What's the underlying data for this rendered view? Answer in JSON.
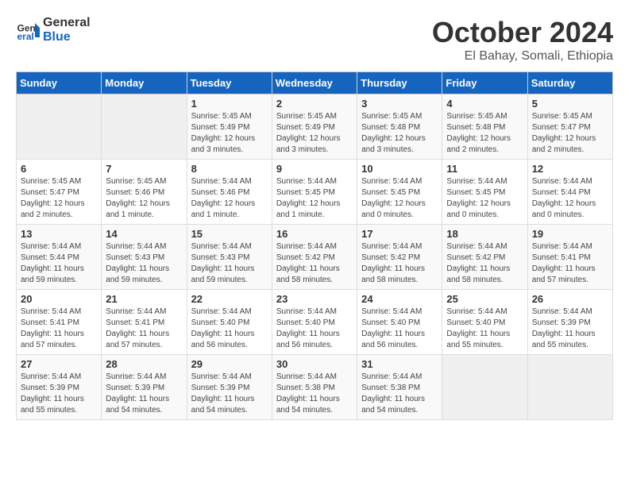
{
  "logo": {
    "line1": "General",
    "line2": "Blue"
  },
  "title": "October 2024",
  "subtitle": "El Bahay, Somali, Ethiopia",
  "weekdays": [
    "Sunday",
    "Monday",
    "Tuesday",
    "Wednesday",
    "Thursday",
    "Friday",
    "Saturday"
  ],
  "weeks": [
    [
      {
        "day": "",
        "info": ""
      },
      {
        "day": "",
        "info": ""
      },
      {
        "day": "1",
        "info": "Sunrise: 5:45 AM\nSunset: 5:49 PM\nDaylight: 12 hours\nand 3 minutes."
      },
      {
        "day": "2",
        "info": "Sunrise: 5:45 AM\nSunset: 5:49 PM\nDaylight: 12 hours\nand 3 minutes."
      },
      {
        "day": "3",
        "info": "Sunrise: 5:45 AM\nSunset: 5:48 PM\nDaylight: 12 hours\nand 3 minutes."
      },
      {
        "day": "4",
        "info": "Sunrise: 5:45 AM\nSunset: 5:48 PM\nDaylight: 12 hours\nand 2 minutes."
      },
      {
        "day": "5",
        "info": "Sunrise: 5:45 AM\nSunset: 5:47 PM\nDaylight: 12 hours\nand 2 minutes."
      }
    ],
    [
      {
        "day": "6",
        "info": "Sunrise: 5:45 AM\nSunset: 5:47 PM\nDaylight: 12 hours\nand 2 minutes."
      },
      {
        "day": "7",
        "info": "Sunrise: 5:45 AM\nSunset: 5:46 PM\nDaylight: 12 hours\nand 1 minute."
      },
      {
        "day": "8",
        "info": "Sunrise: 5:44 AM\nSunset: 5:46 PM\nDaylight: 12 hours\nand 1 minute."
      },
      {
        "day": "9",
        "info": "Sunrise: 5:44 AM\nSunset: 5:45 PM\nDaylight: 12 hours\nand 1 minute."
      },
      {
        "day": "10",
        "info": "Sunrise: 5:44 AM\nSunset: 5:45 PM\nDaylight: 12 hours\nand 0 minutes."
      },
      {
        "day": "11",
        "info": "Sunrise: 5:44 AM\nSunset: 5:45 PM\nDaylight: 12 hours\nand 0 minutes."
      },
      {
        "day": "12",
        "info": "Sunrise: 5:44 AM\nSunset: 5:44 PM\nDaylight: 12 hours\nand 0 minutes."
      }
    ],
    [
      {
        "day": "13",
        "info": "Sunrise: 5:44 AM\nSunset: 5:44 PM\nDaylight: 11 hours\nand 59 minutes."
      },
      {
        "day": "14",
        "info": "Sunrise: 5:44 AM\nSunset: 5:43 PM\nDaylight: 11 hours\nand 59 minutes."
      },
      {
        "day": "15",
        "info": "Sunrise: 5:44 AM\nSunset: 5:43 PM\nDaylight: 11 hours\nand 59 minutes."
      },
      {
        "day": "16",
        "info": "Sunrise: 5:44 AM\nSunset: 5:42 PM\nDaylight: 11 hours\nand 58 minutes."
      },
      {
        "day": "17",
        "info": "Sunrise: 5:44 AM\nSunset: 5:42 PM\nDaylight: 11 hours\nand 58 minutes."
      },
      {
        "day": "18",
        "info": "Sunrise: 5:44 AM\nSunset: 5:42 PM\nDaylight: 11 hours\nand 58 minutes."
      },
      {
        "day": "19",
        "info": "Sunrise: 5:44 AM\nSunset: 5:41 PM\nDaylight: 11 hours\nand 57 minutes."
      }
    ],
    [
      {
        "day": "20",
        "info": "Sunrise: 5:44 AM\nSunset: 5:41 PM\nDaylight: 11 hours\nand 57 minutes."
      },
      {
        "day": "21",
        "info": "Sunrise: 5:44 AM\nSunset: 5:41 PM\nDaylight: 11 hours\nand 57 minutes."
      },
      {
        "day": "22",
        "info": "Sunrise: 5:44 AM\nSunset: 5:40 PM\nDaylight: 11 hours\nand 56 minutes."
      },
      {
        "day": "23",
        "info": "Sunrise: 5:44 AM\nSunset: 5:40 PM\nDaylight: 11 hours\nand 56 minutes."
      },
      {
        "day": "24",
        "info": "Sunrise: 5:44 AM\nSunset: 5:40 PM\nDaylight: 11 hours\nand 56 minutes."
      },
      {
        "day": "25",
        "info": "Sunrise: 5:44 AM\nSunset: 5:40 PM\nDaylight: 11 hours\nand 55 minutes."
      },
      {
        "day": "26",
        "info": "Sunrise: 5:44 AM\nSunset: 5:39 PM\nDaylight: 11 hours\nand 55 minutes."
      }
    ],
    [
      {
        "day": "27",
        "info": "Sunrise: 5:44 AM\nSunset: 5:39 PM\nDaylight: 11 hours\nand 55 minutes."
      },
      {
        "day": "28",
        "info": "Sunrise: 5:44 AM\nSunset: 5:39 PM\nDaylight: 11 hours\nand 54 minutes."
      },
      {
        "day": "29",
        "info": "Sunrise: 5:44 AM\nSunset: 5:39 PM\nDaylight: 11 hours\nand 54 minutes."
      },
      {
        "day": "30",
        "info": "Sunrise: 5:44 AM\nSunset: 5:38 PM\nDaylight: 11 hours\nand 54 minutes."
      },
      {
        "day": "31",
        "info": "Sunrise: 5:44 AM\nSunset: 5:38 PM\nDaylight: 11 hours\nand 54 minutes."
      },
      {
        "day": "",
        "info": ""
      },
      {
        "day": "",
        "info": ""
      }
    ]
  ]
}
